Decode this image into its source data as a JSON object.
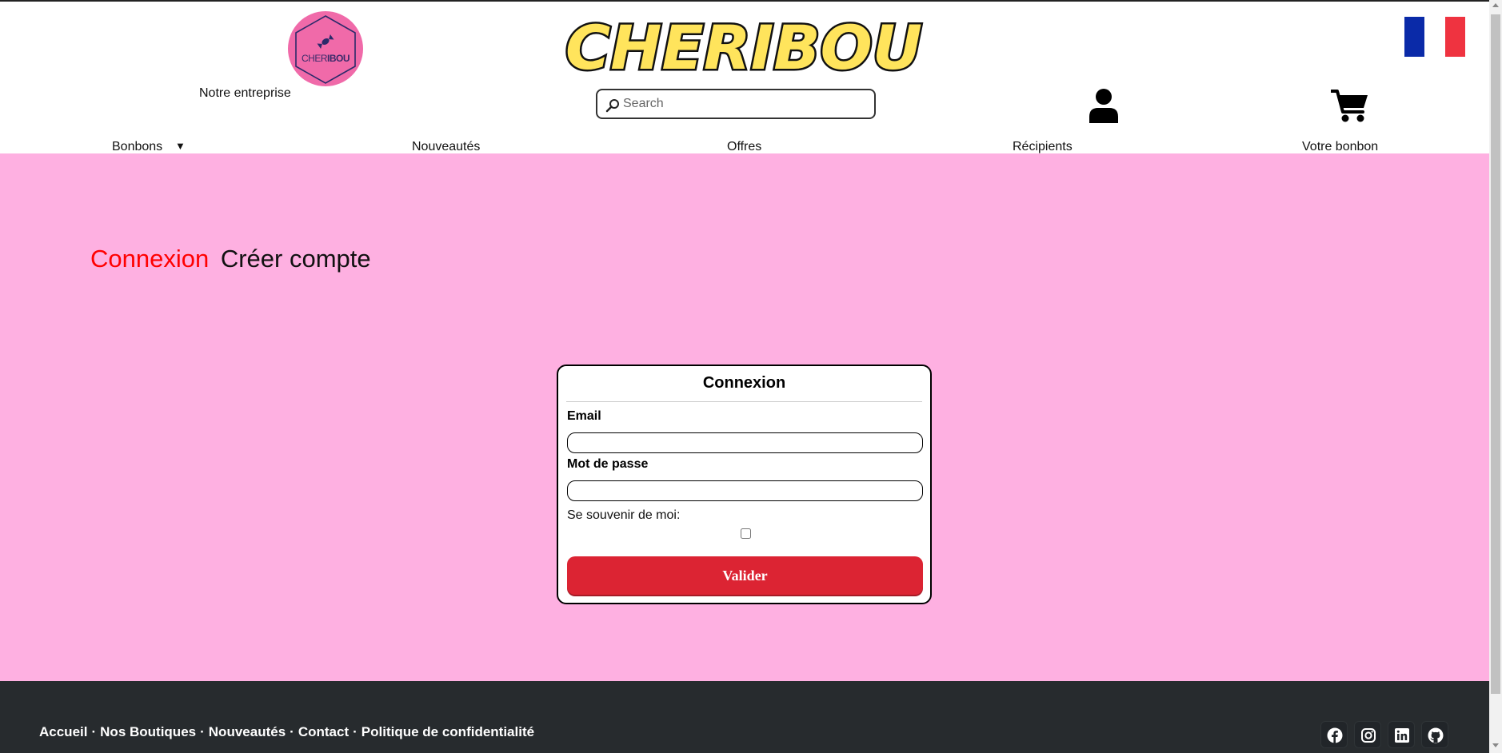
{
  "header": {
    "logo": {
      "text_light": "CHER",
      "text_bold": "IBOU",
      "color": "#f06aa9"
    },
    "company_link": "Notre entreprise",
    "brand_title": "CHERIBOU",
    "brand_colors": {
      "fill": "#ffe45c",
      "outline": "#111111"
    },
    "search": {
      "placeholder": "Search",
      "value": ""
    },
    "language_flag": {
      "icon": "france-flag-icon",
      "colors": [
        "#0a2aa8",
        "#ffffff",
        "#ef3340"
      ]
    },
    "account_icon": "user-icon",
    "cart_icon": "cart-icon"
  },
  "nav": {
    "items": [
      {
        "label": "Bonbons",
        "has_dropdown": true,
        "caret": "▼"
      },
      {
        "label": "Nouveautés"
      },
      {
        "label": "Offres"
      },
      {
        "label": "Récipients"
      },
      {
        "label": "Votre bonbon"
      }
    ]
  },
  "main": {
    "background": "#feb0e1",
    "tabs": [
      {
        "label": "Connexion",
        "active": true,
        "color": "#ff0000"
      },
      {
        "label": "Créer compte",
        "active": false
      }
    ],
    "login_card": {
      "title": "Connexion",
      "email_label": "Email",
      "email_value": "",
      "password_label": "Mot de passe",
      "password_value": "",
      "remember_label": "Se souvenir de moi:",
      "remember_checked": false,
      "submit_label": "Valider",
      "submit_color": "#dc2433"
    }
  },
  "footer": {
    "background": "#272b2e",
    "links": [
      "Accueil",
      "Nos Boutiques",
      "Nouveautés",
      "Contact",
      "Politique de confidentialité"
    ],
    "separator": "·",
    "social_icons": [
      "facebook-icon",
      "instagram-icon",
      "linkedin-icon",
      "github-icon"
    ]
  }
}
